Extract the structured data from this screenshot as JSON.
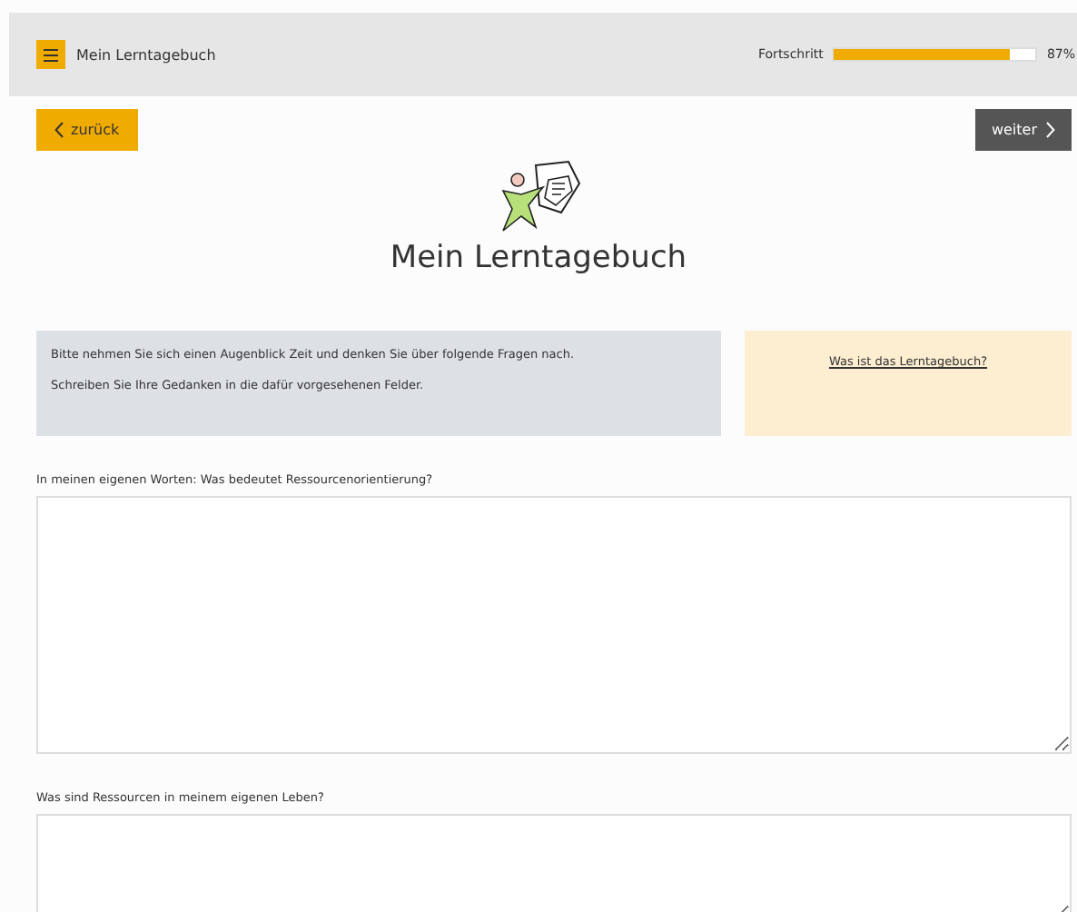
{
  "header": {
    "title": "Mein Lerntagebuch",
    "progress_label": "Fortschritt",
    "progress": {
      "level": 0.87,
      "reading": "87%"
    }
  },
  "nav": {
    "back": "zurück",
    "next": "weiter"
  },
  "page_title": "Mein Lerntagebuch",
  "intro": {
    "lines": [
      "Bitte nehmen Sie sich einen Augenblick Zeit und denken Sie über folgende Fragen nach.",
      "Schreiben Sie Ihre Gedanken in die dafür vorgesehenen Felder."
    ],
    "link": "Was ist das Lerntagebuch?"
  },
  "questions": [
    {
      "label": "In meinen eigenen Worten: Was bedeutet Ressourcenorientierung?"
    },
    {
      "label": "Was sind Ressourcen in meinem eigenen Leben?"
    }
  ]
}
